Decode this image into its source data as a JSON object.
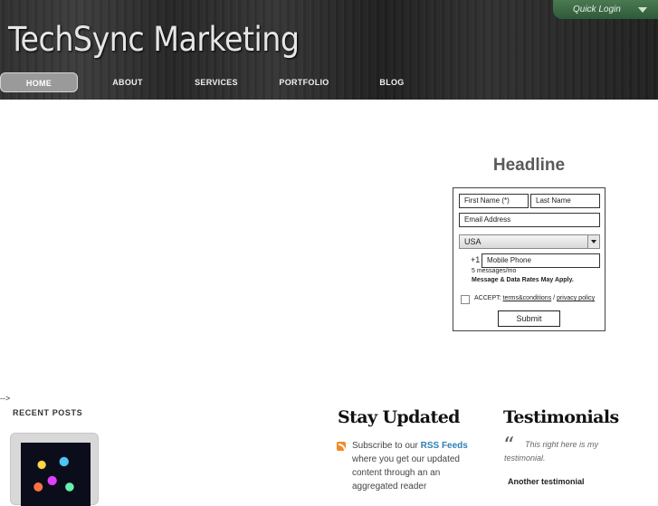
{
  "header": {
    "site_title": "TechSync Marketing",
    "quick_login": "Quick Login"
  },
  "nav": {
    "items": [
      {
        "label": "HOME",
        "active": true
      },
      {
        "label": "ABOUT"
      },
      {
        "label": "SERVICES"
      },
      {
        "label": "PORTFOLIO"
      },
      {
        "label": "BLOG"
      }
    ]
  },
  "form": {
    "headline": "Headline",
    "first_name_placeholder": "First Name (*)",
    "last_name_placeholder": "Last Name",
    "email_placeholder": "Email Address",
    "country_selected": "USA",
    "phone_prefix": "+1",
    "mobile_placeholder": "Mobile Phone",
    "messages_note": "5 messages/mo",
    "rates_note": "Message & Data Rates May Apply.",
    "accept_label": "ACCEPT: ",
    "terms_link": "terms&conditions",
    "separator": " / ",
    "privacy_link": "privacy policy",
    "submit_label": "Submit"
  },
  "stray_text": "-->",
  "sidebar": {
    "recent_posts_title": "RECENT POSTS"
  },
  "stay_updated": {
    "title": "Stay Updated",
    "text_before": "Subscribe to our ",
    "rss_link": "RSS Feeds",
    "text_after": " where you get our updated content through an an aggregated reader"
  },
  "testimonials": {
    "title": "Testimonials",
    "quote": "This right here is my testimonial.",
    "second": "Another testimonial"
  },
  "colors": {
    "quick_login_bg": "#2f5a38",
    "nav_active_bg": "#9a9a9a",
    "rss_link": "#2f7fb5",
    "rss_icon": "#f08a24"
  }
}
